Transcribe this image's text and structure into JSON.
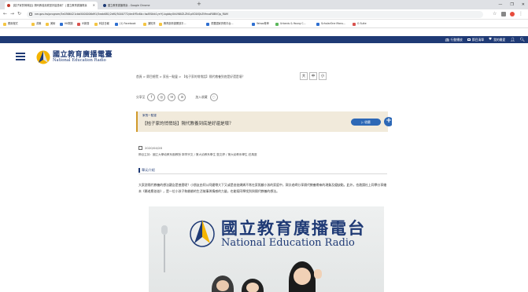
{
  "browser": {
    "tabs": [
      {
        "label": "【桔子家的悄悄話】隔代教養到底是好還是壞？ | 國立教育廣播電臺"
      },
      {
        "label": "國立教育廣播電臺 - Google Chrome"
      }
    ],
    "url": "ner.gov.tw/program/5e0566421cbb5000006d91/5eab681/2df0/5000772/de4ff5c6b=IwAR0kk1yrrYj-bgbbyXkUN8iZLZN1pVD0lQkZt9nssR8BVQp_RAM",
    "window_controls": [
      "—",
      "❐",
      "✕"
    ],
    "bookmarks": [
      "應用程式",
      "書籤",
      "美術",
      "HK開放",
      "IE新聞",
      "科技日報",
      "(1) Facebook",
      "通知事",
      "教育部資源開放平...",
      "重要國家資電平台...",
      "Yahoo奇摩",
      "Urbanis & Young C...",
      "ScholarOne Manu...",
      "G Suite"
    ]
  },
  "site": {
    "topnav": [
      {
        "label": "行動播放",
        "icon": "radio-icon"
      },
      {
        "label": "節目清單",
        "icon": "list-icon"
      },
      {
        "label": "我的最愛",
        "icon": "heart-icon"
      }
    ],
    "logo_cn": "國立教育廣播電臺",
    "logo_en": "National Education Radio"
  },
  "page": {
    "breadcrumb": "首頁 > 節目總覽 > 家長一點靈 > 【桔子家的悄悄話】隔代教養到底是好還是壞？",
    "font_sizes": [
      "大",
      "中",
      "小"
    ],
    "share_label": "分享至",
    "share_icons": [
      "f",
      "◎",
      "✉",
      "⊘"
    ],
    "favorite_label": "加入收藏",
    "program_name": "家長一點靈",
    "episode_title": "【桔子家的悄悄話】隔代教養到底是好還是壞？",
    "play_label": "▷ 收聽",
    "add_label": "+",
    "date": "2020/04/28",
    "people": "節目主持：國立大學幼教系副教授 郭李宗文 / 第大幼教系學生 藍文婷 / 第大幼教系學生 莊禹庭",
    "section_title": "單元介紹",
    "intro_text": "大家對隔代教養的想法觀念是甚麼呢？小朋友由阿公阿嬤帶大下又或是爸爸媽媽不常在家照顧小孩的家庭中，郭文老師分享隔代教養帶來的現象及優缺點，此外，也邀請社上同學分享繪本《屬老鷹爸爸》，是一位小孩子和爺爺的生活故事與情感的力量，也能幫同學找到與隔代教養的想法。",
    "photo_sign_cn": "國立教育廣播電台",
    "photo_sign_en": "National Education Radio"
  }
}
